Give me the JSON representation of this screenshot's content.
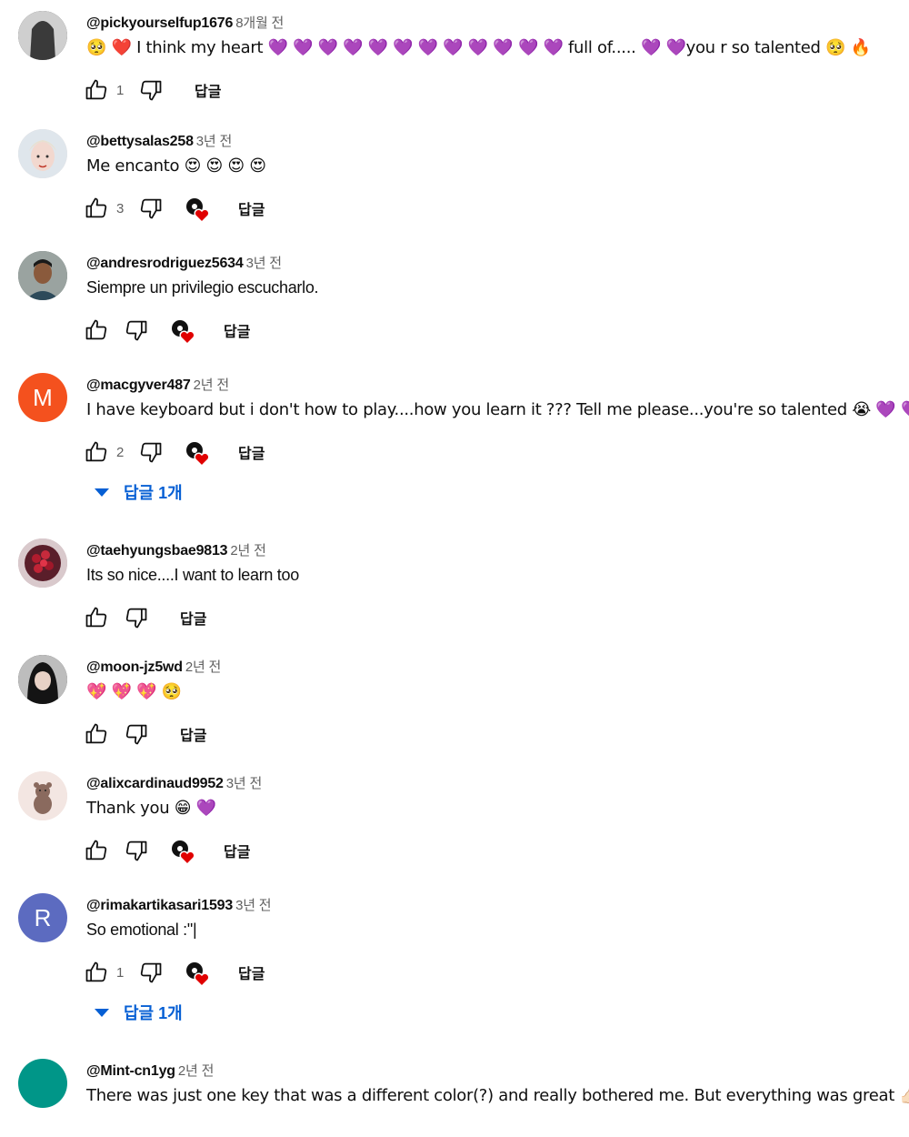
{
  "reply_label": "답글",
  "comments": [
    {
      "handle": "@pickyourselfup1676",
      "time": "8개월 전",
      "text": "🥺 ❤️ I think my heart 💜 💜 💜 💜 💜 💜 💜 💜 💜 💜 💜 💜 full of..... 💜 💜you r so talented 🥺 🔥",
      "likes": "1",
      "creator_heart": false,
      "replies": ""
    },
    {
      "handle": "@bettysalas258",
      "time": "3년 전",
      "text": "Me encanto  😍 😍 😍 😍",
      "likes": "3",
      "creator_heart": true,
      "replies": ""
    },
    {
      "handle": "@andresrodriguez5634",
      "time": "3년 전",
      "text": "Siempre un privilegio escucharlo.",
      "likes": "",
      "creator_heart": true,
      "replies": ""
    },
    {
      "handle": "@macgyver487",
      "time": "2년 전",
      "text": "I have keyboard but i don't how to play....how you learn it ??? Tell me please...you're so talented 😭 💜 💜 💜",
      "likes": "2",
      "creator_heart": true,
      "replies": "답글 1개"
    },
    {
      "handle": "@taehyungsbae9813",
      "time": "2년 전",
      "text": "Its so nice....I want to learn too",
      "likes": "",
      "creator_heart": false,
      "replies": ""
    },
    {
      "handle": "@moon-jz5wd",
      "time": "2년 전",
      "text": "💖 💖 💖 🥺",
      "likes": "",
      "creator_heart": false,
      "replies": ""
    },
    {
      "handle": "@alixcardinaud9952",
      "time": "3년 전",
      "text": "Thank you 😁 💜",
      "likes": "",
      "creator_heart": true,
      "replies": ""
    },
    {
      "handle": "@rimakartikasari1593",
      "time": "3년 전",
      "text": "So emotional :\"|",
      "likes": "1",
      "creator_heart": true,
      "replies": "답글 1개"
    },
    {
      "handle": "@Mint-cn1yg",
      "time": "2년 전",
      "text": "There was just one key that was a different color(?) and really bothered me. But everything was great 👍🏻",
      "likes": "",
      "creator_heart": false,
      "replies": ""
    }
  ],
  "avatars": [
    {
      "kind": "photo",
      "color": "#3a3a3a",
      "letter": ""
    },
    {
      "kind": "photo",
      "color": "#e9d7d2",
      "letter": ""
    },
    {
      "kind": "photo",
      "color": "#5f6f6a",
      "letter": ""
    },
    {
      "kind": "letter",
      "color": "#f4511e",
      "letter": "M"
    },
    {
      "kind": "photo",
      "color": "#c5a8b0",
      "letter": ""
    },
    {
      "kind": "photo",
      "color": "#2a2a2a",
      "letter": ""
    },
    {
      "kind": "photo",
      "color": "#f2e4e0",
      "letter": ""
    },
    {
      "kind": "letter",
      "color": "#5c6bc0",
      "letter": "R"
    },
    {
      "kind": "letter",
      "color": "#009688",
      "letter": ""
    }
  ],
  "colors": {
    "link": "#065fd4",
    "secondary_text": "#606060",
    "heart": "#e00000"
  }
}
